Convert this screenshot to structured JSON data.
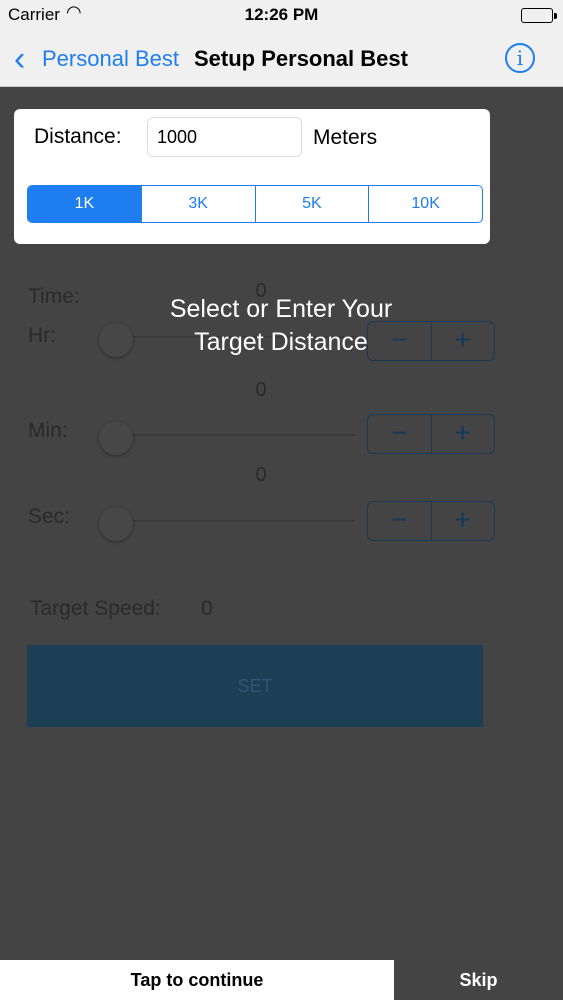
{
  "status_bar": {
    "carrier": "Carrier",
    "time": "12:26 PM"
  },
  "nav": {
    "back_label": "Personal Best",
    "title": "Setup Personal Best"
  },
  "distance": {
    "label": "Distance:",
    "value": "1000",
    "unit": "Meters",
    "presets": [
      "1K",
      "3K",
      "5K",
      "10K"
    ],
    "selected": "1K"
  },
  "time": {
    "label": "Time:",
    "hours": {
      "label": "Hr:",
      "value": "0"
    },
    "minutes": {
      "label": "Min:",
      "value": "0"
    },
    "seconds": {
      "label": "Sec:",
      "value": "0"
    }
  },
  "stepper": {
    "minus": "−",
    "plus": "+"
  },
  "target_speed": {
    "label": "Target Speed:",
    "value": "0"
  },
  "set_button": "SET",
  "tutorial": {
    "message": "Select or Enter Your Target Distance",
    "tap_label": "Tap to continue",
    "skip_label": "Skip"
  },
  "colors": {
    "accent": "#1e7ef0",
    "overlay": "#444444"
  }
}
